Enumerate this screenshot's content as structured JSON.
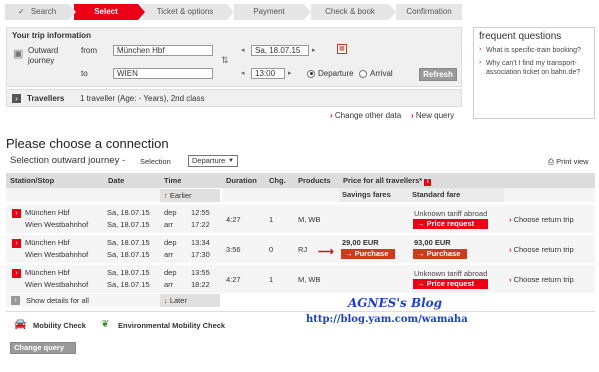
{
  "steps": [
    {
      "label": "Search"
    },
    {
      "label": "Select"
    },
    {
      "label": "Ticket & options"
    },
    {
      "label": "Payment"
    },
    {
      "label": "Check & book"
    },
    {
      "label": "Confirmation"
    }
  ],
  "trip": {
    "header": "Your trip information",
    "outward_label": "Outward",
    "journey_label": "journey",
    "from_label": "from",
    "from_value": "München Hbf",
    "to_label": "to",
    "to_value": "WIEN",
    "date_value": "Sa, 18.07.15",
    "time_value": "13:00",
    "departure_label": "Departure",
    "arrival_label": "Arrival",
    "refresh_label": "Refresh"
  },
  "travellers": {
    "label": "Travellers",
    "value": "1 traveller (Age: - Years), 2nd class"
  },
  "links": {
    "change_other": "Change other data",
    "new_query": "New query"
  },
  "faq": {
    "title": "frequent questions",
    "items": [
      "What is specific-train booking?",
      "Why can't I find my transport-association ticket on bahn.de?"
    ]
  },
  "main": {
    "title": "Please choose a connection",
    "subtitle": "Selection outward journey  -",
    "selection_label": "Selection",
    "selection_value": "Departure",
    "print_view": "Print view"
  },
  "table": {
    "headers": [
      "Station/Stop",
      "Date",
      "Time",
      "Duration",
      "Chg.",
      "Products",
      "Price for all travellers*"
    ],
    "savings_fares": "Savings fares",
    "standard_fare": "Standard fare",
    "earlier": "Earlier",
    "later": "Later",
    "dep": "dep",
    "arr": "arr",
    "rows": [
      {
        "from": "München Hbf",
        "to": "Wien Westbahnhof",
        "date1": "Sa, 18.07.15",
        "date2": "Sa, 18.07.15",
        "dep": "12:55",
        "arr": "17:22",
        "duration": "4:27",
        "changes": "1",
        "products": "M, WB",
        "savings": "",
        "savings_btn": "",
        "standard": "Unknown tariff abroad",
        "standard_btn": "Price request",
        "choose": "Choose return trip"
      },
      {
        "from": "München Hbf",
        "to": "Wien Westbahnhof",
        "date1": "Sa, 18.07.15",
        "date2": "Sa, 18.07.15",
        "dep": "13:34",
        "arr": "17:30",
        "duration": "3:56",
        "changes": "0",
        "products": "RJ",
        "savings": "29,00 EUR",
        "savings_btn": "Purchase",
        "standard": "93,00 EUR",
        "standard_btn": "Purchase",
        "choose": "Choose return trip"
      },
      {
        "from": "München Hbf",
        "to": "Wien Westbahnhof",
        "date1": "Sa, 18.07.15",
        "date2": "Sa, 18.07.15",
        "dep": "13:55",
        "arr": "18:22",
        "duration": "4:27",
        "changes": "1",
        "products": "M, WB",
        "savings": "",
        "savings_btn": "",
        "standard": "Unknown tariff abroad",
        "standard_btn": "Price request",
        "choose": "Choose return trip"
      }
    ],
    "show_details": "Show details for all"
  },
  "footer": {
    "mobility": "Mobility Check",
    "env": "Environmental Mobility Check",
    "change_query": "Change query"
  },
  "watermark": {
    "title": "AGNES's Blog",
    "url": "http://blog.yam.com/wamaha"
  },
  "colors": {
    "accent": "#ec0016",
    "header_bg": "#dcdcdc",
    "box_bg": "#f0f0f0"
  }
}
